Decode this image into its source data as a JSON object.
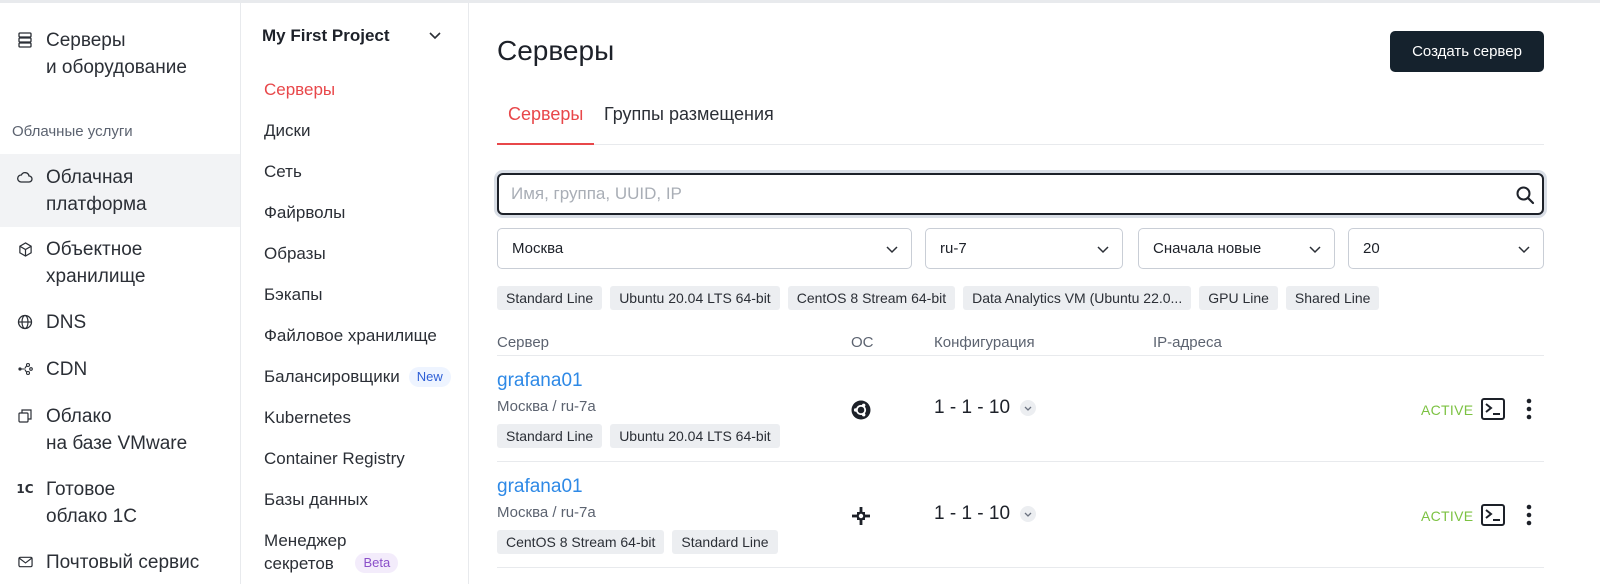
{
  "nav": {
    "items": [
      {
        "icon": "server-icon",
        "label": "Серверы\nи оборудование"
      },
      {
        "icon": "cloud-icon",
        "label": "Облачная\nплатформа"
      },
      {
        "icon": "cube-icon",
        "label": "Объектное\nхранилище"
      },
      {
        "icon": "globe-icon",
        "label": "DNS"
      },
      {
        "icon": "cdn-icon",
        "label": "CDN"
      },
      {
        "icon": "vmware-icon",
        "label": "Облако\nна базе VMware"
      },
      {
        "icon": "1c-icon",
        "label": "Готовое\nоблако 1С"
      },
      {
        "icon": "mail-icon",
        "label": "Почтовый сервис"
      }
    ],
    "section_label": "Облачные услуги"
  },
  "project": {
    "title": "My First Project",
    "items": [
      {
        "label": "Серверы"
      },
      {
        "label": "Диски"
      },
      {
        "label": "Сеть"
      },
      {
        "label": "Файрволы"
      },
      {
        "label": "Образы"
      },
      {
        "label": "Бэкапы"
      },
      {
        "label": "Файловое хранилище"
      },
      {
        "label": "Балансировщики",
        "badge": "New"
      },
      {
        "label": "Kubernetes"
      },
      {
        "label": "Container Registry"
      },
      {
        "label": "Базы данных"
      },
      {
        "label": "Менеджер\nсекретов",
        "badge": "Beta"
      }
    ]
  },
  "main": {
    "title": "Серверы",
    "create_button": "Создать сервер",
    "tabs": [
      {
        "label": "Серверы"
      },
      {
        "label": "Группы размещения"
      }
    ],
    "search": {
      "placeholder": "Имя, группа, UUID, IP",
      "value": ""
    },
    "selects": [
      {
        "value": "Москва"
      },
      {
        "value": "ru-7"
      },
      {
        "value": "Сначала новые"
      },
      {
        "value": "20"
      }
    ],
    "filters": [
      "Standard Line",
      "Ubuntu 20.04 LTS 64-bit",
      "CentOS 8 Stream 64-bit",
      "Data Analytics VM (Ubuntu 22.0...",
      "GPU Line",
      "Shared Line"
    ],
    "columns": {
      "server": "Сервер",
      "os": "ОС",
      "config": "Конфигурация",
      "ip": "IP-адреса"
    },
    "rows": [
      {
        "name": "grafana01",
        "location": "Москва / ru-7a",
        "tags": [
          "Standard Line",
          "Ubuntu 20.04 LTS 64-bit"
        ],
        "os_icon": "ubuntu-icon",
        "config": "1 - 1 - 10",
        "status": "ACTIVE"
      },
      {
        "name": "grafana01",
        "location": "Москва / ru-7a",
        "tags": [
          "CentOS 8 Stream 64-bit",
          "Standard Line"
        ],
        "os_icon": "centos-icon",
        "config": "1 - 1 - 10",
        "status": "ACTIVE"
      }
    ]
  },
  "colors": {
    "accent": "#e8474a",
    "link": "#2e89e6",
    "status_active": "#7cc242",
    "primary_button": "#15222d"
  }
}
